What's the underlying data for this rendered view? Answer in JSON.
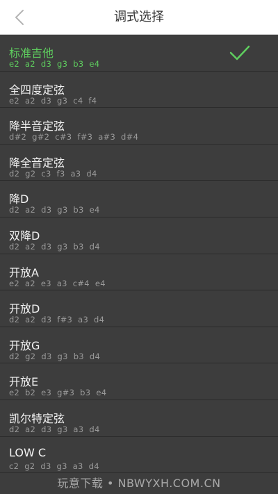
{
  "header": {
    "title": "调式选择",
    "back_icon": "chevron-left-icon"
  },
  "colors": {
    "selected_accent": "#5fcf5f",
    "background": "#3d3d3d",
    "header_bg": "#ffffff"
  },
  "tunings": [
    {
      "name": "标准吉他",
      "notes": "e2 a2 d3 g3 b3 e4",
      "selected": true
    },
    {
      "name": "全四度定弦",
      "notes": "e2 a2 d3 g3 c4 f4",
      "selected": false
    },
    {
      "name": "降半音定弦",
      "notes": "d#2 g#2 c#3 f#3 a#3 d#4",
      "selected": false
    },
    {
      "name": "降全音定弦",
      "notes": "d2 g2 c3 f3 a3 d4",
      "selected": false
    },
    {
      "name": "降D",
      "notes": "d2 a2 d3 g3 b3 e4",
      "selected": false
    },
    {
      "name": "双降D",
      "notes": "d2 a2 d3 g3 b3 d4",
      "selected": false
    },
    {
      "name": "开放A",
      "notes": "e2 a2 e3 a3 c#4 e4",
      "selected": false
    },
    {
      "name": "开放D",
      "notes": "d2 a2 d3 f#3 a3 d4",
      "selected": false
    },
    {
      "name": "开放G",
      "notes": "d2 g2 d3 g3 b3 d4",
      "selected": false
    },
    {
      "name": "开放E",
      "notes": "e2 b2 e3 g#3 b3 e4",
      "selected": false
    },
    {
      "name": "凯尔特定弦",
      "notes": "d2 a2 d3 g3 a3 d4",
      "selected": false
    },
    {
      "name": "LOW C",
      "notes": "c2 g2 d3 g3 a3 d4",
      "selected": false
    }
  ],
  "watermark": "玩意下载 • NBWYXH.COM.CN"
}
